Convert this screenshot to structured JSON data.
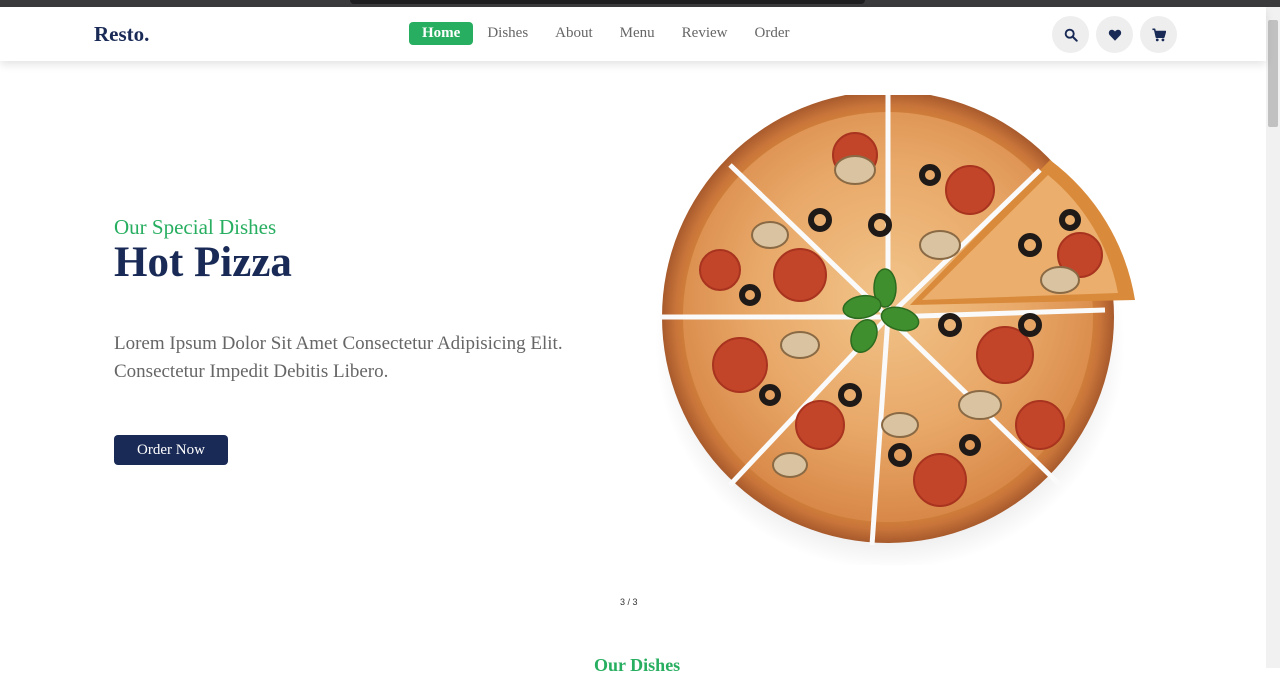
{
  "header": {
    "logo": "Resto.",
    "nav": [
      "Home",
      "Dishes",
      "About",
      "Menu",
      "Review",
      "Order"
    ],
    "active_nav": "Home",
    "icons": [
      "search-icon",
      "heart-icon",
      "cart-icon"
    ]
  },
  "hero": {
    "subtitle": "Our Special Dishes",
    "title": "Hot Pizza",
    "text": "Lorem Ipsum Dolor Sit Amet Consectetur Adipisicing Elit. Consectetur Impedit Debitis Libero.",
    "button": "Order Now",
    "pager": "3 / 3"
  },
  "next_section": {
    "heading": "Our Dishes"
  },
  "colors": {
    "primary": "#192a56",
    "accent": "#27ae60",
    "text_muted": "#666666",
    "icon_bg": "#eeeeee"
  }
}
